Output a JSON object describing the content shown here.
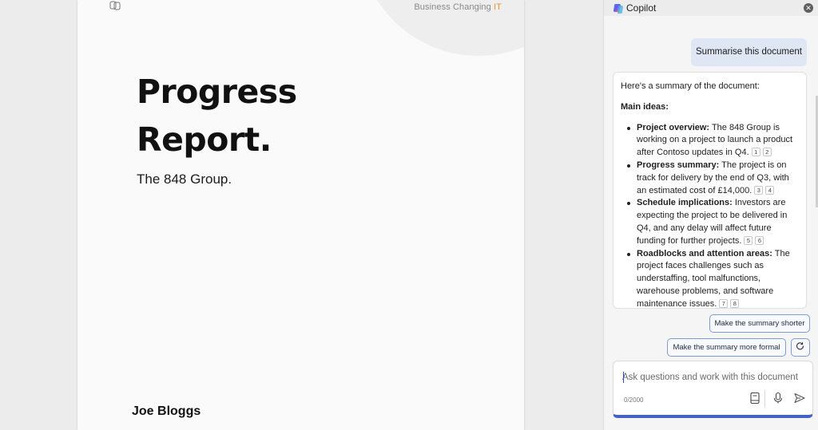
{
  "document": {
    "brand_text": "Business Changing ",
    "brand_accent": "IT",
    "title_line1": "Progress",
    "title_line2": "Report.",
    "subtitle": "The 848 Group.",
    "author": "Joe Bloggs"
  },
  "copilot": {
    "title": "Copilot",
    "close_icon": "close-icon",
    "user_message": "Summarise this document",
    "response": {
      "intro": "Here's a summary of the document:",
      "heading": "Main ideas:",
      "items": [
        {
          "label": "Project overview:",
          "text": " The 848 Group is working on a project to launch a product after Contoso updates in Q4.",
          "cites": [
            "1",
            "2"
          ]
        },
        {
          "label": "Progress summary:",
          "text": " The project is on track for delivery by the end of Q3, with an estimated cost of £14,000.",
          "cites": [
            "3",
            "4"
          ]
        },
        {
          "label": "Schedule implications:",
          "text": " Investors are expecting the project to be delivered in Q4, and any delay will affect future funding for further projects.",
          "cites": [
            "5",
            "6"
          ]
        },
        {
          "label": "Roadblocks and attention areas:",
          "text": " The project faces challenges such as understaffing, tool malfunctions, warehouse problems, and software maintenance issues.",
          "cites": [
            "7",
            "8"
          ]
        }
      ]
    },
    "suggestions": [
      "Make the summary shorter",
      "Make the summary more formal"
    ],
    "input": {
      "placeholder": "Ask questions and work with this document",
      "char_count": "0/2000"
    },
    "colors": {
      "accent": "#4563c5",
      "bubble": "#dfe6f4",
      "brand_accent": "#e8962f"
    }
  }
}
